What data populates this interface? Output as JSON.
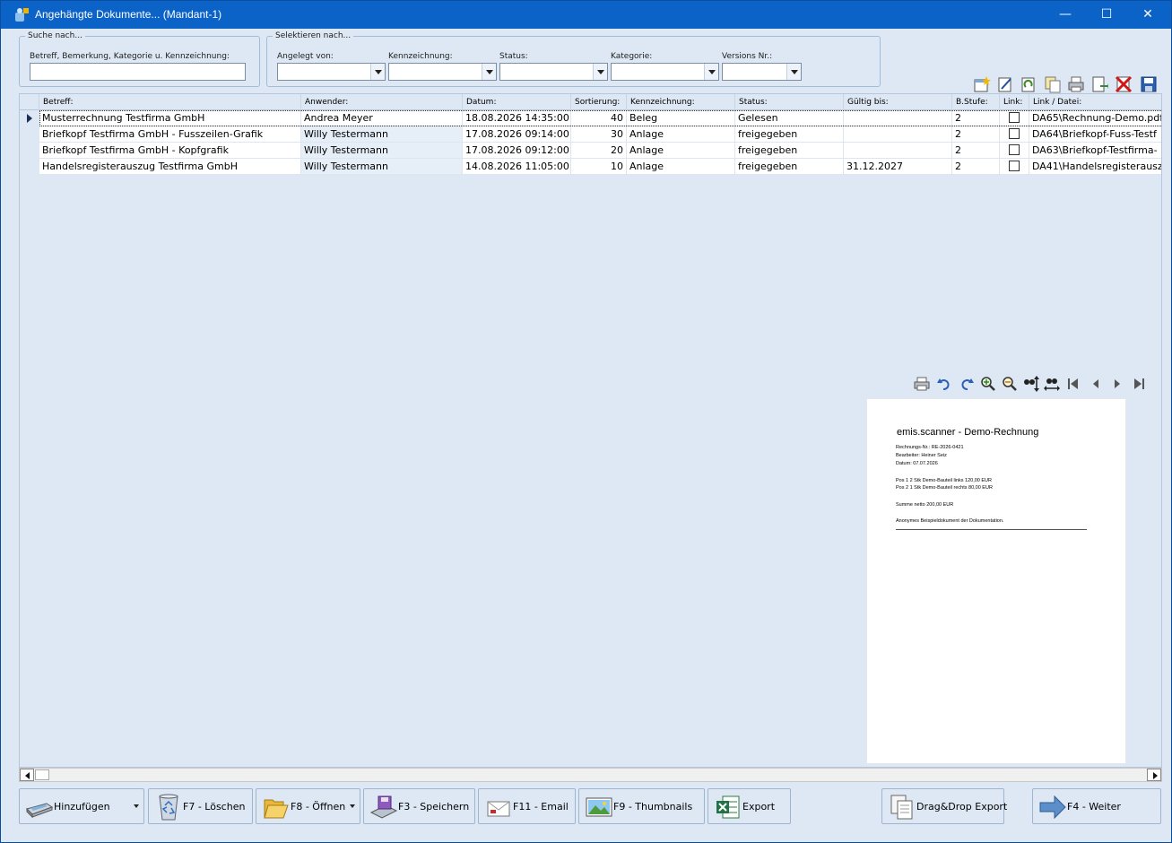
{
  "window": {
    "title": "Angehängte Dokumente... (Mandant-1)",
    "minimize": "—",
    "maximize": "☐",
    "close": "✕"
  },
  "search_group": {
    "legend": "Suche nach...",
    "label": "Betreff, Bemerkung, Kategorie u. Kennzeichnung:",
    "value": ""
  },
  "filter_group": {
    "legend": "Selektieren nach...",
    "filters": [
      {
        "label": "Angelegt von:",
        "value": ""
      },
      {
        "label": "Kennzeichnung:",
        "value": ""
      },
      {
        "label": "Status:",
        "value": ""
      },
      {
        "label": "Kategorie:",
        "value": ""
      },
      {
        "label": "Versions Nr.:",
        "value": ""
      }
    ]
  },
  "toolbar": {
    "icons": [
      "add-star-icon",
      "edit-icon",
      "refresh-icon",
      "copy-icon",
      "print-icon",
      "export-doc-icon",
      "delete-icon",
      "save-icon"
    ]
  },
  "table": {
    "columns": [
      "Betreff:",
      "Anwender:",
      "Datum:",
      "Sortierung:",
      "Kennzeichnung:",
      "Status:",
      "Gültig bis:",
      "B.Stufe:",
      "Link:",
      "Link / Datei:"
    ],
    "rows": [
      {
        "betreff": "Musterrechnung Testfirma GmbH",
        "anwender": "Andrea Meyer",
        "datum": "18.08.2026 14:35:00",
        "sortierung": "40",
        "kennzeichnung": "Beleg",
        "status": "Gelesen",
        "gueltig": "",
        "stufe": "2",
        "datei": "DA65\\Rechnung-Demo.pdf"
      },
      {
        "betreff": "Briefkopf Testfirma GmbH - Fusszeilen-Grafik",
        "anwender": "Willy Testermann",
        "datum": "17.08.2026 09:14:00",
        "sortierung": "30",
        "kennzeichnung": "Anlage",
        "status": "freigegeben",
        "gueltig": "",
        "stufe": "2",
        "datei": "DA64\\Briefkopf-Fuss-Testf"
      },
      {
        "betreff": "Briefkopf Testfirma GmbH - Kopfgrafik",
        "anwender": "Willy Testermann",
        "datum": "17.08.2026 09:12:00",
        "sortierung": "20",
        "kennzeichnung": "Anlage",
        "status": "freigegeben",
        "gueltig": "",
        "stufe": "2",
        "datei": "DA63\\Briefkopf-Testfirma-"
      },
      {
        "betreff": "Handelsregisterauszug Testfirma GmbH",
        "anwender": "Willy Testermann",
        "datum": "14.08.2026 11:05:00",
        "sortierung": "10",
        "kennzeichnung": "Anlage",
        "status": "freigegeben",
        "gueltig": "31.12.2027",
        "stufe": "2",
        "datei": "DA41\\Handelsregisterausz"
      }
    ]
  },
  "preview": {
    "title": "emis.scanner - Demo-Rechnung",
    "lines": [
      "Rechnungs-Nr.: RE-2026-0421",
      "Bearbeiter: Heiner Seiz",
      "Datum: 07.07.2026",
      "Pos 1  2 Stk  Demo-Bauteil links        120,00 EUR",
      "Pos 2  1 Stk  Demo-Bauteil rechts        80,00 EUR",
      "Summe netto                       200,00 EUR",
      "Anonymes Beispieldokument der Dokumentation."
    ]
  },
  "buttons": {
    "hinzufuegen": "Hinzufügen",
    "loeschen": "F7 - Löschen",
    "oeffnen": "F8 - Öffnen",
    "speichern": "F3 - Speichern",
    "email": "F11 - Email",
    "thumbnails": "F9 - Thumbnails",
    "export": "Export",
    "dragdrop": "Drag&Drop Export",
    "weiter": "F4 - Weiter"
  }
}
